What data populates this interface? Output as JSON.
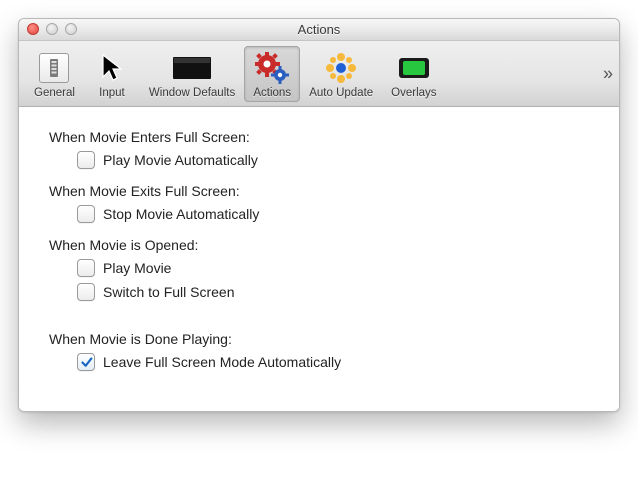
{
  "window": {
    "title": "Actions"
  },
  "toolbar": {
    "tabs": [
      {
        "label": "General"
      },
      {
        "label": "Input"
      },
      {
        "label": "Window Defaults"
      },
      {
        "label": "Actions"
      },
      {
        "label": "Auto Update"
      },
      {
        "label": "Overlays"
      }
    ],
    "overflow_glyph": "»"
  },
  "sections": {
    "enter_fs": {
      "heading": "When Movie Enters Full Screen:",
      "opt_play_auto": "Play Movie Automatically"
    },
    "exit_fs": {
      "heading": "When Movie Exits Full Screen:",
      "opt_stop_auto": "Stop Movie Automatically"
    },
    "opened": {
      "heading": "When Movie is Opened:",
      "opt_play": "Play Movie",
      "opt_fullscreen": "Switch to Full Screen"
    },
    "done": {
      "heading": "When Movie is Done Playing:",
      "opt_leave_fs": "Leave Full Screen Mode Automatically"
    }
  },
  "state": {
    "enter_fs_play_auto": false,
    "exit_fs_stop_auto": false,
    "opened_play": false,
    "opened_fullscreen": false,
    "done_leave_fs": true
  }
}
